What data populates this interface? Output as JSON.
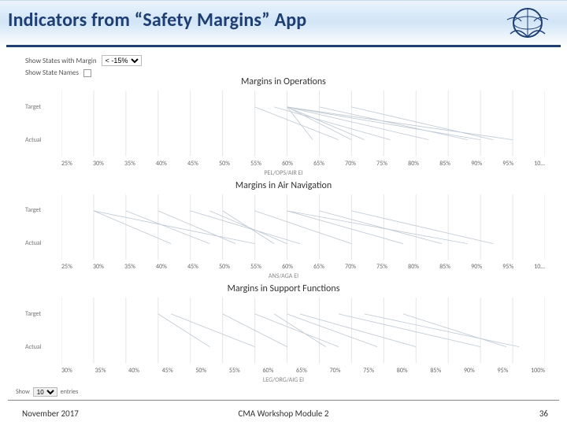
{
  "header": {
    "title": "Indicators from “Safety Margins” App"
  },
  "controls": {
    "show_states_label": "Show States with Margin",
    "margin_select_value": "< -15%",
    "show_names_label": "Show State Names"
  },
  "panels": [
    {
      "title": "Margins in Operations",
      "sublabel": "PEL/OPS/AIR EI"
    },
    {
      "title": "Margins in Air Navigation",
      "sublabel": "ANS/AGA EI"
    },
    {
      "title": "Margins in Support Functions",
      "sublabel": "LEG/ORG/AIG EI"
    }
  ],
  "ylabels": [
    "Target",
    "Actual"
  ],
  "xaxes": [
    [
      "25%",
      "30%",
      "35%",
      "40%",
      "45%",
      "50%",
      "55%",
      "60%",
      "65%",
      "70%",
      "75%",
      "80%",
      "85%",
      "90%",
      "95%",
      "10…"
    ],
    [
      "25%",
      "30%",
      "35%",
      "40%",
      "45%",
      "50%",
      "55%",
      "60%",
      "65%",
      "70%",
      "75%",
      "80%",
      "85%",
      "90%",
      "95%",
      "10…"
    ],
    [
      "30%",
      "35%",
      "40%",
      "45%",
      "50%",
      "55%",
      "60%",
      "65%",
      "70%",
      "75%",
      "80%",
      "85%",
      "90%",
      "95%",
      "100%"
    ]
  ],
  "show_entries": {
    "prefix": "Show",
    "count": "10",
    "suffix": "entries"
  },
  "footer": {
    "left": "November 2017",
    "center": "CMA Workshop Module 2",
    "right": "36"
  },
  "chart_data": {
    "type": "line",
    "note": "parallel-coordinates style; each panel shows many States as a line from Target-% to Actual-%",
    "axes": [
      "Target",
      "Actual"
    ],
    "x_range_pct": [
      25,
      100
    ],
    "panels": [
      {
        "name": "Margins in Operations",
        "sublabel": "PEL/OPS/AIR EI",
        "states": [
          {
            "target": 60,
            "actual": 70
          },
          {
            "target": 60,
            "actual": 82
          },
          {
            "target": 60,
            "actual": 90
          },
          {
            "target": 60,
            "actual": 95
          },
          {
            "target": 60,
            "actual": 72
          },
          {
            "target": 60,
            "actual": 64
          },
          {
            "target": 65,
            "actual": 88
          },
          {
            "target": 70,
            "actual": 92
          },
          {
            "target": 58,
            "actual": 76
          },
          {
            "target": 55,
            "actual": 68
          }
        ]
      },
      {
        "name": "Margins in Air Navigation",
        "sublabel": "ANS/AGA EI",
        "states": [
          {
            "target": 30,
            "actual": 42
          },
          {
            "target": 30,
            "actual": 55
          },
          {
            "target": 35,
            "actual": 48
          },
          {
            "target": 45,
            "actual": 62
          },
          {
            "target": 48,
            "actual": 60
          },
          {
            "target": 50,
            "actual": 58
          },
          {
            "target": 60,
            "actual": 78
          },
          {
            "target": 60,
            "actual": 88
          },
          {
            "target": 65,
            "actual": 84
          },
          {
            "target": 70,
            "actual": 92
          },
          {
            "target": 55,
            "actual": 70
          },
          {
            "target": 40,
            "actual": 52
          }
        ]
      },
      {
        "name": "Margins in Support Functions",
        "sublabel": "LEG/ORG/AIG EI",
        "states": [
          {
            "target": 40,
            "actual": 48
          },
          {
            "target": 42,
            "actual": 55
          },
          {
            "target": 50,
            "actual": 60
          },
          {
            "target": 55,
            "actual": 68
          },
          {
            "target": 60,
            "actual": 74
          },
          {
            "target": 62,
            "actual": 80
          },
          {
            "target": 68,
            "actual": 90
          },
          {
            "target": 72,
            "actual": 96
          },
          {
            "target": 78,
            "actual": 94
          },
          {
            "target": 58,
            "actual": 66
          }
        ]
      }
    ]
  }
}
